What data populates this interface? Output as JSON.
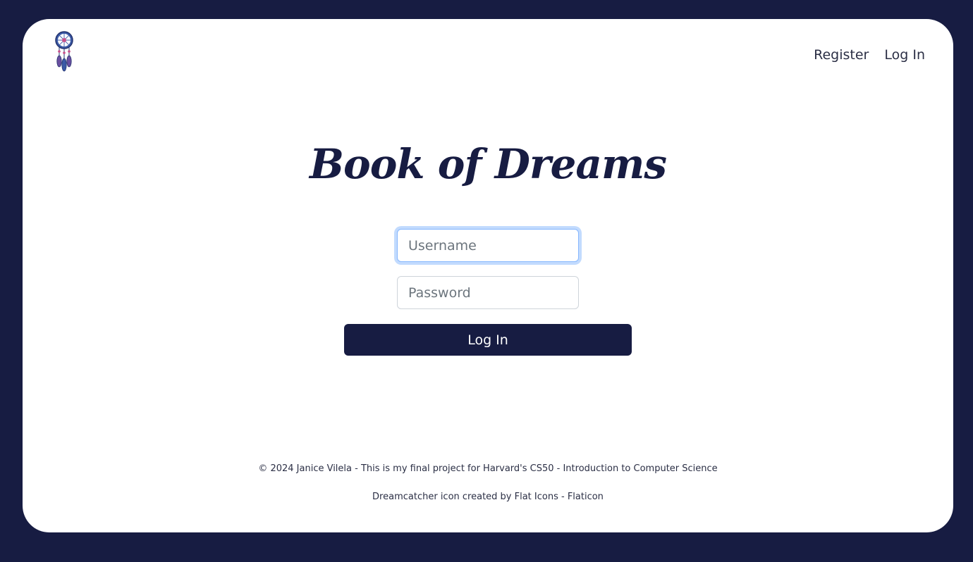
{
  "header": {
    "logo_icon": "dreamcatcher-icon",
    "nav": {
      "register_label": "Register",
      "login_label": "Log In"
    }
  },
  "main": {
    "title": "Book of Dreams",
    "username_placeholder": "Username",
    "password_placeholder": "Password",
    "submit_label": "Log In"
  },
  "footer": {
    "credit": "© 2024 Janice Vilela - This is my final project for Harvard's CS50 - Introduction to Computer Science",
    "icon_credit": "Dreamcatcher icon created by Flat Icons - Flaticon"
  },
  "colors": {
    "background": "#171c42",
    "card": "#ffffff",
    "primary": "#171c42",
    "focus_ring": "#86b7fe"
  }
}
